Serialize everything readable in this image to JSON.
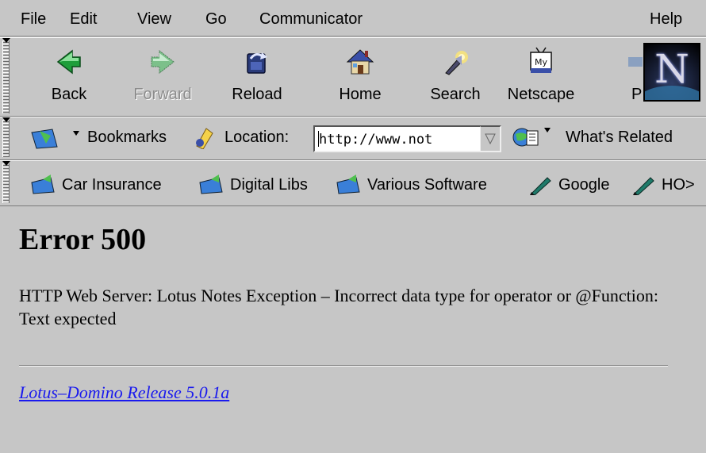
{
  "menubar": {
    "items": [
      "File",
      "Edit",
      "View",
      "Go",
      "Communicator"
    ],
    "help": "Help"
  },
  "navbar": {
    "back": "Back",
    "forward": "Forward",
    "reload": "Reload",
    "home": "Home",
    "search": "Search",
    "netscape": "Netscape",
    "print_partial": "P"
  },
  "locbar": {
    "bookmarks": "Bookmarks",
    "location_label": "Location:",
    "url": "http://www.not",
    "whats_related": "What's Related"
  },
  "persbar": {
    "items": [
      "Car Insurance",
      "Digital Libs",
      "Various Software",
      "Google",
      "HO>"
    ]
  },
  "content": {
    "title": "Error 500",
    "message": "HTTP Web Server: Lotus Notes Exception – Incorrect data type for operator or @Function: Text expected",
    "footer_link": "Lotus–Domino Release 5.0.1a"
  },
  "colors": {
    "chrome": "#c6c6c6",
    "link": "#1a1aee",
    "back_arrow": "#1f9e3a",
    "folder": "#3a7fd8",
    "pen": "#1f7a6a"
  }
}
